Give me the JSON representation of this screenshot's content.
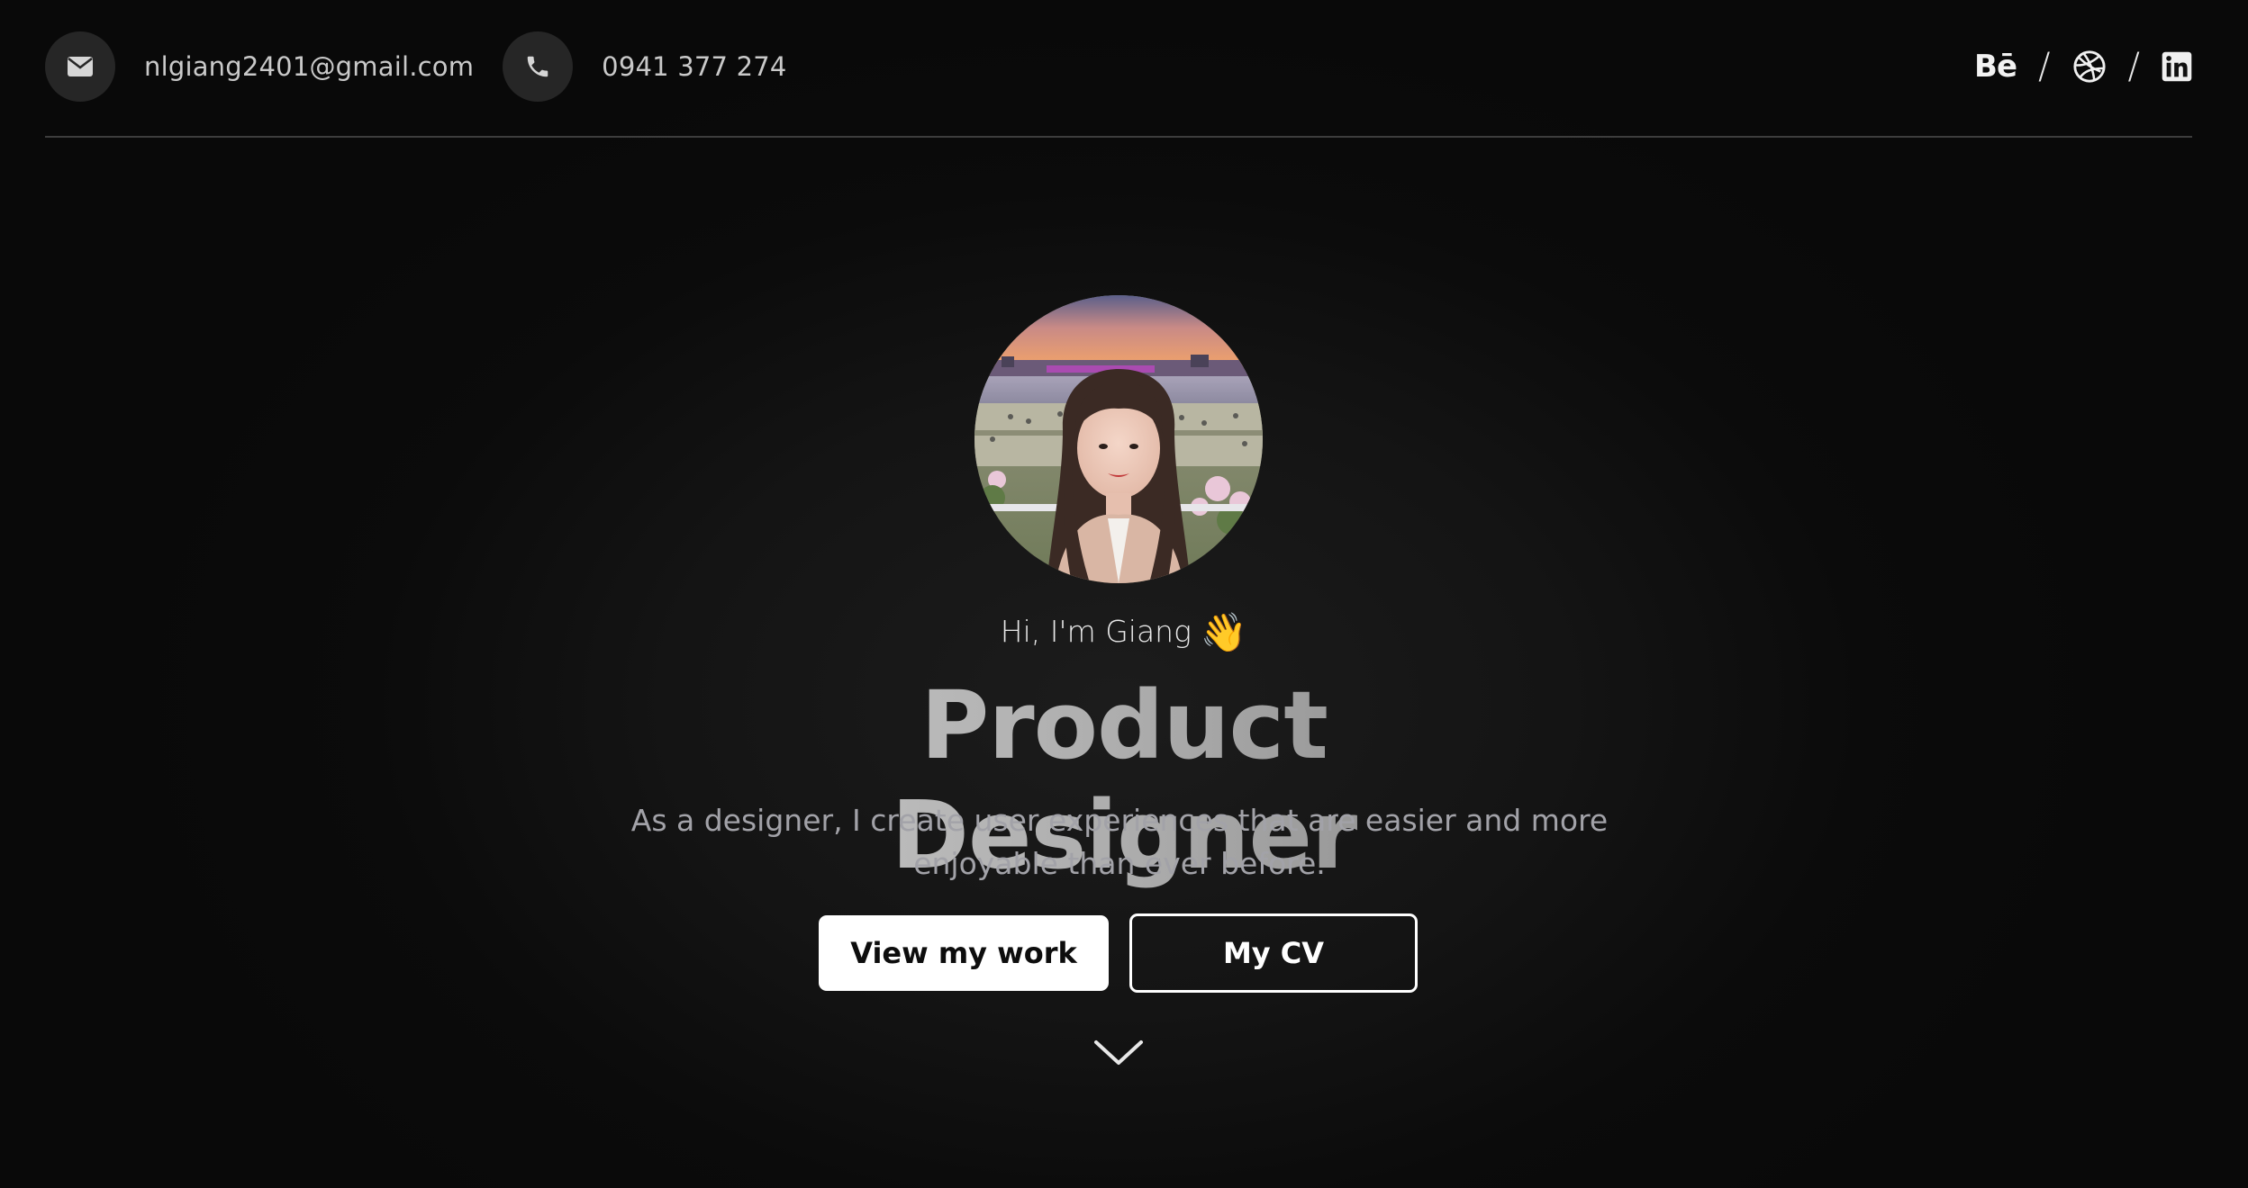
{
  "header": {
    "email": "nlgiang2401@gmail.com",
    "phone": "0941 377 274",
    "socials": [
      {
        "name": "behance",
        "label": "Bē"
      },
      {
        "name": "dribbble",
        "icon": "dribbble-icon"
      },
      {
        "name": "linkedin",
        "icon": "linkedin-icon"
      }
    ],
    "separator": "/"
  },
  "hero": {
    "greeting": "Hi, I'm Giang",
    "wave_emoji": "👋",
    "headline": "Product Designer",
    "subtitle": "As a designer, I create user experiences that are easier and more enjoyable than ever before.",
    "primary_button": "View my work",
    "secondary_button": "My CV"
  },
  "colors": {
    "background": "#0a0a0a",
    "icon_circle": "#262626",
    "accent_button": "#ffffff"
  }
}
